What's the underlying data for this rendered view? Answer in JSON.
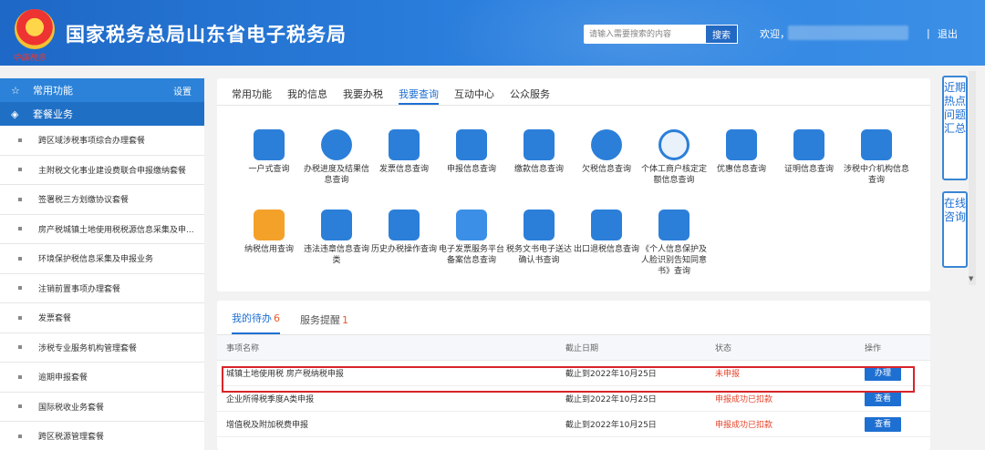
{
  "header": {
    "title": "国家税务总局山东省电子税务局",
    "emblem_text": "中国税务",
    "search_placeholder": "请输入需要搜索的内容",
    "search_button": "搜索",
    "welcome": "欢迎，",
    "separator": "|",
    "logout": "退出"
  },
  "sidebar": {
    "common_label": "常用功能",
    "settings_label": "设置",
    "package_label": "套餐业务",
    "items": [
      "跨区域涉税事项综合办理套餐",
      "主附税文化事业建设费联合申报缴纳套餐",
      "签署税三方划缴协议套餐",
      "房产税城镇土地使用税税源信息采集及申...",
      "环境保护税信息采集及申报业务",
      "注销前置事项办理套餐",
      "发票套餐",
      "涉税专业服务机构管理套餐",
      "逾期申报套餐",
      "国际税收业务套餐",
      "跨区税源管理套餐"
    ]
  },
  "main": {
    "tabs": [
      "常用功能",
      "我的信息",
      "我要办税",
      "我要查询",
      "互动中心",
      "公众服务"
    ],
    "active_tab": 3,
    "grid": [
      {
        "label": "一户式查询",
        "icon": "monitor-icon",
        "color": "#2b7fd9"
      },
      {
        "label": "办税进度及结果信息查询",
        "icon": "pie-chart-icon",
        "color": "#2b7fd9"
      },
      {
        "label": "发票信息查询",
        "icon": "invoice-yen-icon",
        "color": "#2b7fd9"
      },
      {
        "label": "申报信息查询",
        "icon": "book-person-icon",
        "color": "#2b7fd9"
      },
      {
        "label": "缴款信息查询",
        "icon": "wallet-icon",
        "color": "#2b7fd9"
      },
      {
        "label": "欠税信息查询",
        "icon": "yen-coin-icon",
        "color": "#2b7fd9"
      },
      {
        "label": "个体工商户核定定额信息查询",
        "icon": "shop-icon",
        "color": "#2b7fd9"
      },
      {
        "label": "优惠信息查询",
        "icon": "tag-icon",
        "color": "#2b7fd9"
      },
      {
        "label": "证明信息查询",
        "icon": "certificate-icon",
        "color": "#2b7fd9"
      },
      {
        "label": "涉税中介机构信息查询",
        "icon": "org-chart-icon",
        "color": "#2b7fd9"
      },
      {
        "label": "纳税信用查询",
        "icon": "thumbs-up-icon",
        "color": "#f4a12a"
      },
      {
        "label": "违法违章信息查询类",
        "icon": "violation-icon",
        "color": "#2b7fd9"
      },
      {
        "label": "历史办税操作查询",
        "icon": "history-bars-icon",
        "color": "#2b7fd9"
      },
      {
        "label": "电子发票服务平台备案信息查询",
        "icon": "e-invoice-icon",
        "color": "#2b7fd9"
      },
      {
        "label": "税务文书电子送达确认书查询",
        "icon": "document-chart-icon",
        "color": "#2b7fd9"
      },
      {
        "label": "出口退税信息查询",
        "icon": "export-rebate-icon",
        "color": "#2b7fd9"
      },
      {
        "label": "《个人信息保护及人脸识别告知同意书》查询",
        "icon": "person-home-icon",
        "color": "#2b7fd9"
      }
    ]
  },
  "todo": {
    "tabs": [
      {
        "label": "我的待办",
        "count": "6"
      },
      {
        "label": "服务提醒",
        "count": "1"
      }
    ],
    "columns": [
      "事项名称",
      "截止日期",
      "状态",
      "操作"
    ],
    "rows": [
      {
        "name": "城镇土地使用税 房产税纳税申报",
        "deadline": "截止到2022年10月25日",
        "status": "未申报",
        "action": "办理"
      },
      {
        "name": "企业所得税季度A类申报",
        "deadline": "截止到2022年10月25日",
        "status": "申报成功已扣款",
        "action": "查看"
      },
      {
        "name": "增值税及附加税费申报",
        "deadline": "截止到2022年10月25日",
        "status": "申报成功已扣款",
        "action": "查看"
      }
    ]
  },
  "float": {
    "hot_topics": "近期热点问题汇总",
    "online": "在线咨询"
  },
  "colors": {
    "primary": "#1e6fd2",
    "alert": "#e5432a",
    "highlight_border": "#d8242a"
  }
}
